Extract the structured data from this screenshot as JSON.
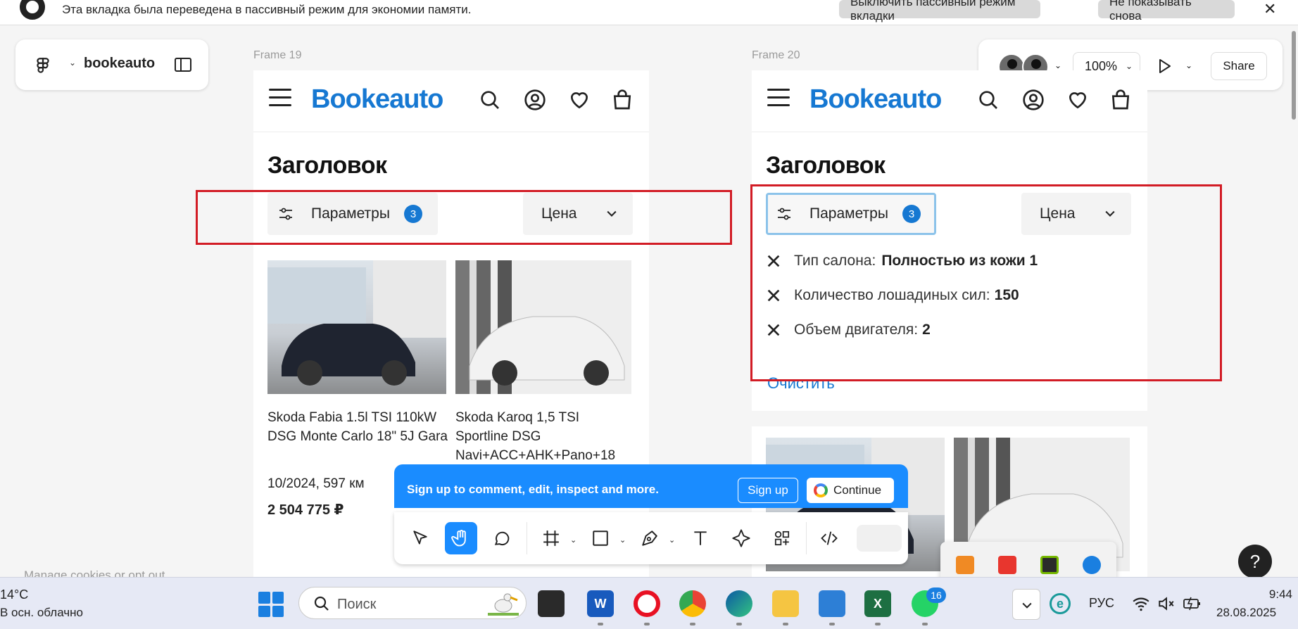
{
  "notification": {
    "text": "Эта вкладка была переведена в пассивный режим для экономии памяти.",
    "disable_btn": "Выключить пассивный режим вкладки",
    "dont_show_btn": "Не показывать снова",
    "close": "✕"
  },
  "figma": {
    "file_name": "bookeauto",
    "zoom": "100%",
    "share": "Share",
    "manage_cookies": "Manage cookies or opt out",
    "help": "?"
  },
  "frames": [
    {
      "label": "Frame 19",
      "brand": "Bookeauto",
      "heading": "Заголовок",
      "params_label": "Параметры",
      "params_count": "3",
      "sort_label": "Цена",
      "cars": [
        {
          "title": "Skoda Fabia 1.5l TSI 110kW DSG Monte Carlo 18\" 5J Gara",
          "meta": "10/2024, 597 км",
          "price": "2 504 775 ₽"
        },
        {
          "title": "Skoda Karoq 1,5 TSI Sportline DSG Navi+ACC+AHK+Pano+18"
        }
      ]
    },
    {
      "label": "Frame 20",
      "brand": "Bookeauto",
      "heading": "Заголовок",
      "params_label": "Параметры",
      "params_count": "3",
      "sort_label": "Цена",
      "filters": [
        {
          "label": "Тип салона:",
          "value": "Полностью из кожи 1"
        },
        {
          "label": "Количество лошадиных сил:",
          "value": "150"
        },
        {
          "label": "Объем двигателя:",
          "value": "2"
        }
      ],
      "clear": "Очистить"
    }
  ],
  "signup": {
    "text": "Sign up to comment, edit, inspect and more.",
    "signup_btn": "Sign up",
    "continue_btn": "Continue"
  },
  "taskbar": {
    "temperature": "14°C",
    "weather": "В осн. облачно",
    "search_placeholder": "Поиск",
    "whatsapp_badge": "16",
    "language": "РУС",
    "time": "9:44",
    "date": "28.08.2025"
  },
  "colors": {
    "brand_blue": "#1678d2",
    "figma_blue": "#1a8cff",
    "highlight_red": "#d21c25"
  }
}
